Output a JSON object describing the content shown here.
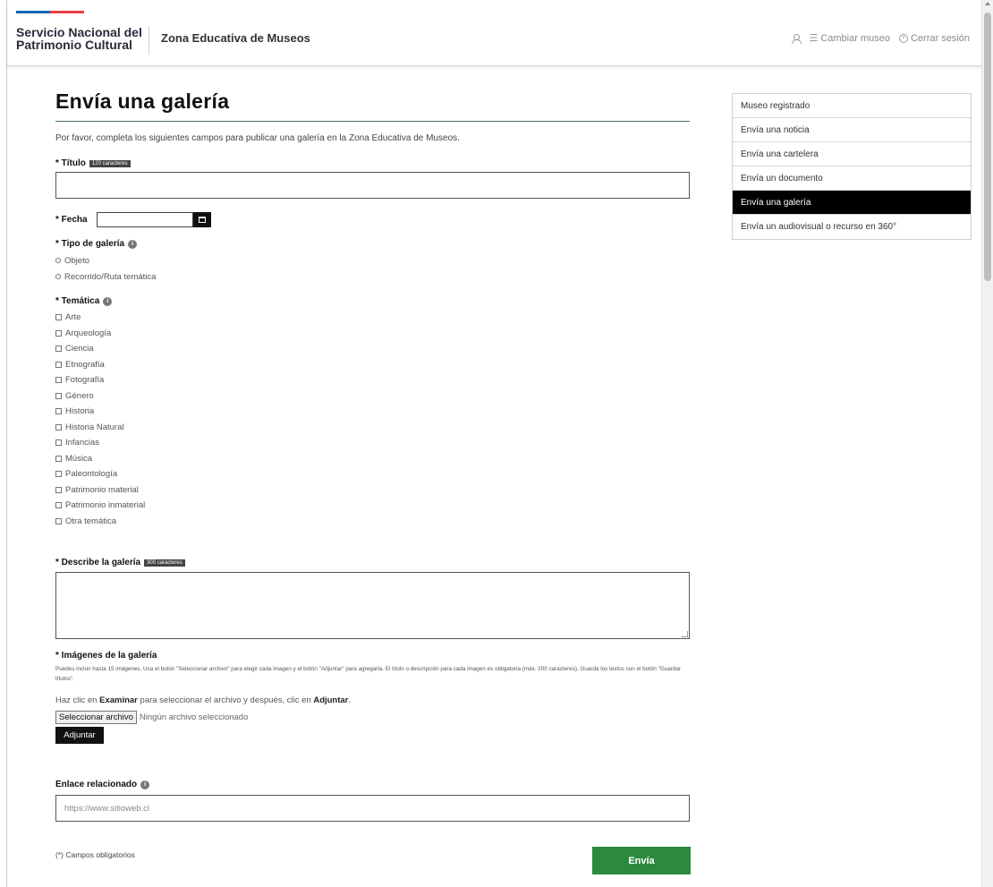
{
  "header": {
    "brand": "Servicio Nacional del Patrimonio Cultural",
    "zone": "Zona Educativa de Museos",
    "cambiar_museo": "Cambiar museo",
    "cerrar_sesion": "Cerrar sesión",
    "flag_colors": [
      "#0f69b4",
      "#eb3c46"
    ]
  },
  "main": {
    "title": "Envía una galería",
    "intro": "Por favor, completa los siguientes campos para publicar una galería en la Zona Educativa de Museos.",
    "titulo": {
      "label": "* Título",
      "badge": "120 caracteres",
      "value": ""
    },
    "fecha": {
      "label": "* Fecha",
      "value": ""
    },
    "tipo": {
      "label": "* Tipo de galería",
      "options": [
        "Objeto",
        "Recorrido/Ruta temática"
      ]
    },
    "tematica": {
      "label": "* Temática",
      "options": [
        "Arte",
        "Arqueología",
        "Ciencia",
        "Etnografía",
        "Fotografía",
        "Género",
        "Historia",
        "Historia Natural",
        "Infancias",
        "Música",
        "Paleontología",
        "Patrimonio material",
        "Patrimonio inmaterial",
        "Otra temática"
      ]
    },
    "describe": {
      "label": "* Describe la galería",
      "badge": "300 caracteres",
      "value": ""
    },
    "imagenes": {
      "label": "* Imágenes de la galería",
      "help": "Puedes incluir hasta 15 imágenes. Usa el botón \"Seleccionar archivo\" para elegir cada imagen y el botón \"Adjuntar\" para agregarla. El título o descripción para cada imagen es obligatoria (máx. 200 caracteres). Guarda los textos con el botón \"Guardar títulos\".",
      "hint_pre": "Haz clic en ",
      "hint_b1": "Examinar",
      "hint_mid": " para seleccionar el archivo y después, clic en ",
      "hint_b2": "Adjuntar",
      "hint_end": ".",
      "file_button": "Seleccionar archivo",
      "file_status": "Ningún archivo seleccionado",
      "adjuntar": "Adjuntar"
    },
    "enlace": {
      "label": "Enlace relacionado",
      "placeholder": "https://www.sitioweb.cl"
    },
    "obligatorios": "(*) Campos obligatorios",
    "submit": "Envía",
    "submit_color": "#2b8a3e"
  },
  "sidebar": {
    "items": [
      {
        "label": "Museo registrado",
        "active": false
      },
      {
        "label": "Envía una noticia",
        "active": false
      },
      {
        "label": "Envía una cartelera",
        "active": false
      },
      {
        "label": "Envía un documento",
        "active": false
      },
      {
        "label": "Envía una galería",
        "active": true
      },
      {
        "label": "Envía un audiovisual o recurso en 360°",
        "active": false
      }
    ]
  }
}
